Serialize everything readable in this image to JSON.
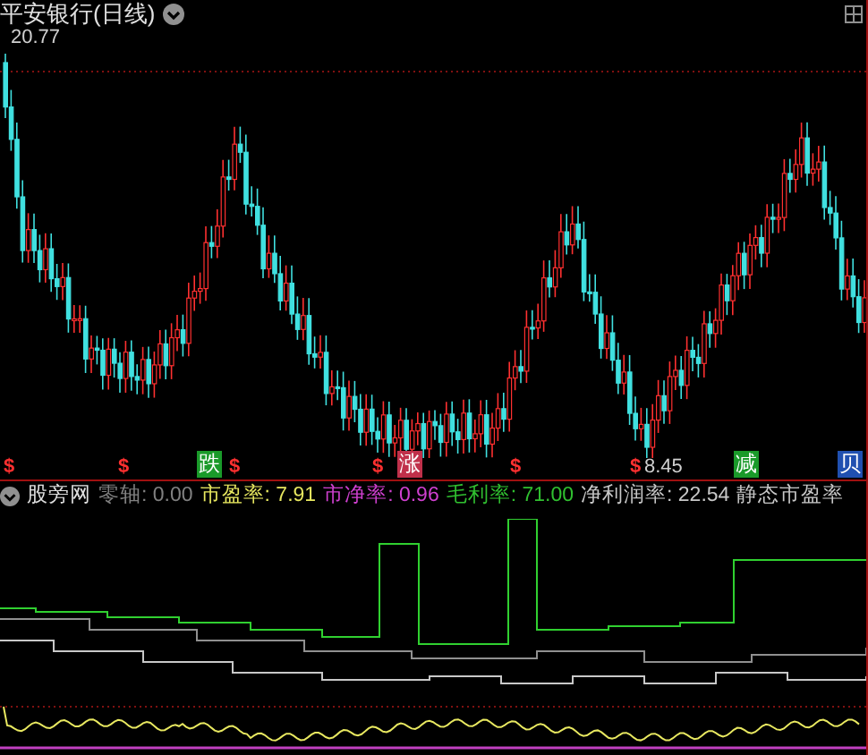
{
  "title": "平安银行(日线)",
  "price_chart": {
    "high_label": "20.77",
    "low_label": "8.45"
  },
  "markers": [
    {
      "kind": "dollar",
      "text": "$"
    },
    {
      "kind": "dollar",
      "text": "$"
    },
    {
      "kind": "badge",
      "text": "跌",
      "color": "#1a9a2a"
    },
    {
      "kind": "dollar",
      "text": "$"
    },
    {
      "kind": "dollar",
      "text": "$"
    },
    {
      "kind": "badge",
      "text": "涨",
      "color": "#c0304a"
    },
    {
      "kind": "dollar",
      "text": "$"
    },
    {
      "kind": "dollar",
      "text": "$"
    },
    {
      "kind": "badge",
      "text": "减",
      "color": "#1a9a2a"
    },
    {
      "kind": "badge",
      "text": "贝",
      "color": "#2050b0"
    }
  ],
  "indicator": {
    "name": "股旁网",
    "items": [
      {
        "text": "零轴: 0.00",
        "color": "#808080"
      },
      {
        "text": "市盈率: 7.91",
        "color": "#e8e860"
      },
      {
        "text": "市净率: 0.96",
        "color": "#d040d0"
      },
      {
        "text": "毛利率: 71.00",
        "color": "#30c030"
      },
      {
        "text": "净利润率: 22.54",
        "color": "#c8c8c8"
      },
      {
        "text": "静态市盈率",
        "color": "#c8c8c8"
      }
    ]
  }
}
